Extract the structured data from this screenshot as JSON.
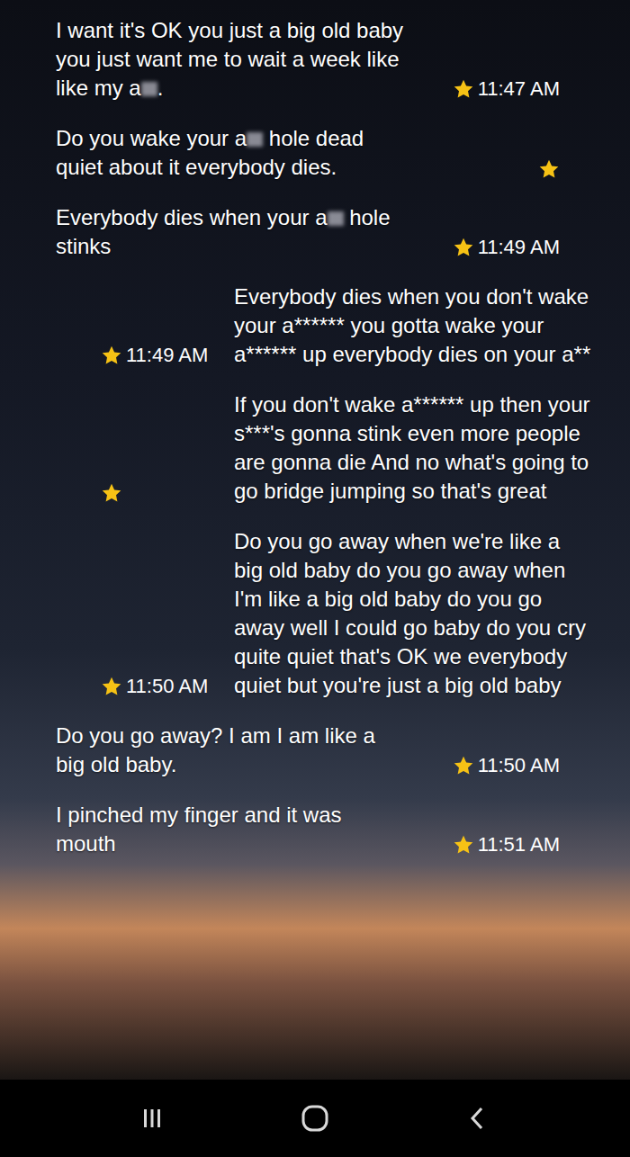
{
  "messages": [
    {
      "side": "left",
      "starred": true,
      "time": "11:47 AM",
      "parts": [
        {
          "kind": "text",
          "text": "I want it's OK you just a big old baby you just want me to wait a week like like my a"
        },
        {
          "kind": "blur",
          "text": ""
        },
        {
          "kind": "text",
          "text": "."
        }
      ]
    },
    {
      "side": "left",
      "starred": true,
      "time": "",
      "parts": [
        {
          "kind": "text",
          "text": "Do you wake your a"
        },
        {
          "kind": "blur",
          "text": ""
        },
        {
          "kind": "text",
          "text": " hole dead quiet about it everybody dies."
        }
      ]
    },
    {
      "side": "left",
      "starred": true,
      "time": "11:49 AM",
      "parts": [
        {
          "kind": "text",
          "text": "Everybody dies when your a"
        },
        {
          "kind": "blur",
          "text": ""
        },
        {
          "kind": "text",
          "text": " hole stinks"
        }
      ]
    },
    {
      "side": "right",
      "starred": true,
      "time": "11:49 AM",
      "parts": [
        {
          "kind": "text",
          "text": "Everybody dies when you don't wake your a****** you gotta wake your a****** up everybody dies on your a**"
        }
      ]
    },
    {
      "side": "right",
      "starred": true,
      "time": "",
      "parts": [
        {
          "kind": "text",
          "text": "If you don't wake a****** up then your s***'s gonna stink even more people are gonna die And no what's going to go bridge jumping so that's great"
        }
      ]
    },
    {
      "side": "right",
      "starred": true,
      "time": "11:50 AM",
      "parts": [
        {
          "kind": "text",
          "text": "Do you go away when we're like a big old baby do you go away when I'm like a big old baby do you go away well I could go baby do you cry quite quiet that's OK we everybody quiet but you're just a big old baby"
        }
      ]
    },
    {
      "side": "left",
      "starred": true,
      "time": "11:50 AM",
      "parts": [
        {
          "kind": "text",
          "text": "Do you go away? I am I am like a big old baby."
        }
      ]
    },
    {
      "side": "left",
      "starred": true,
      "time": "11:51 AM",
      "parts": [
        {
          "kind": "text",
          "text": "I pinched my finger and it was mouth"
        }
      ]
    }
  ]
}
